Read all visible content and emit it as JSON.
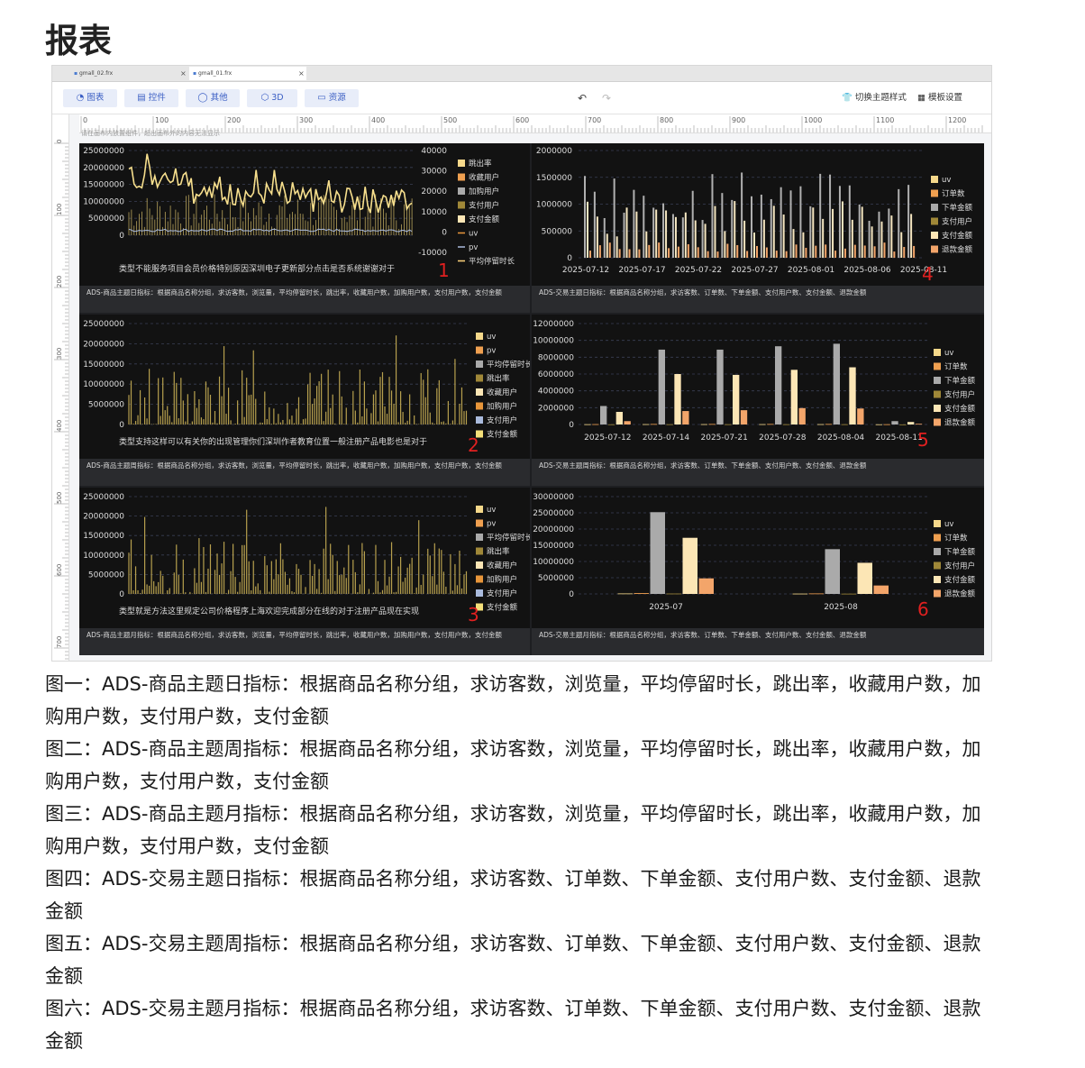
{
  "page_title": "报表",
  "tabs": [
    {
      "label": "gmall_02.frx",
      "close": "×"
    },
    {
      "label": "gmall_01.frx",
      "close": "×"
    }
  ],
  "toolbar": {
    "buttons": [
      {
        "label": "图表",
        "icon": "chart-icon"
      },
      {
        "label": "控件",
        "icon": "widget-icon"
      },
      {
        "label": "其他",
        "icon": "other-icon"
      },
      {
        "label": "3D",
        "icon": "cube-icon"
      },
      {
        "label": "资源",
        "icon": "resource-icon"
      }
    ],
    "undo": "↶",
    "redo": "↷",
    "switch_theme": "切换主题样式",
    "template_settings": "模板设置"
  },
  "ruler": {
    "h_ticks": [
      "0",
      "100",
      "200",
      "300",
      "400",
      "500",
      "600",
      "700",
      "800",
      "900",
      "1000",
      "1100",
      "1200"
    ],
    "v_ticks": [
      "0",
      "100",
      "200",
      "300",
      "400",
      "500",
      "600",
      "700"
    ]
  },
  "hint": "请在画布内放置组件，超出画布外的内容无法显示",
  "panels": [
    {
      "marker": "1",
      "subtitle": "类型不能服务项目会员价格特别原因深圳电子更新部分点击是否系统谢谢对于",
      "desc": "ADS-商品主题日指标：根据商品名称分组，求访客数，浏览量，平均停留时长，跳出率，收藏用户数，加购用户数，支付用户数，支付金额",
      "chart_data": {
        "type": "line",
        "y_left_ticks": [
          "25000000",
          "20000000",
          "15000000",
          "10000000",
          "5000000",
          "0"
        ],
        "y_right_ticks": [
          "40000",
          "30000",
          "20000",
          "10000",
          "0",
          "-10000"
        ],
        "legend": [
          "跳出率",
          "收藏用户",
          "加购用户",
          "支付用户",
          "支付金额",
          "uv",
          "pv",
          "平均停留时长"
        ],
        "legend_colors": [
          "#f5d88a",
          "#f0a050",
          "#aaaaaa",
          "#a08838",
          "#fce6b5",
          "#e8963a",
          "#aabbdd",
          "#ffd27a"
        ],
        "grid": true,
        "legend_position": "right"
      }
    },
    {
      "marker": "2",
      "subtitle": "类型支持这样可以有关你的出现管理你们深圳作者教育位置一般注册产品电影也是对于",
      "desc": "ADS-商品主题周指标：根据商品名称分组，求访客数，浏览量，平均停留时长，跳出率，收藏用户数，加购用户数，支付用户数，支付金额",
      "chart_data": {
        "type": "bar",
        "y_ticks": [
          "25000000",
          "20000000",
          "15000000",
          "10000000",
          "5000000",
          "0"
        ],
        "legend": [
          "uv",
          "pv",
          "平均停留时长",
          "跳出率",
          "收藏用户",
          "加购用户",
          "支付用户",
          "支付金额"
        ],
        "legend_colors": [
          "#f5d88a",
          "#f0a050",
          "#aaaaaa",
          "#a08838",
          "#fce6b5",
          "#e8963a",
          "#aabbdd",
          "#f5e07a"
        ],
        "grid": true,
        "legend_position": "right"
      }
    },
    {
      "marker": "3",
      "subtitle": "类型就是方法这里规定公司价格程序上海欢迎完成部分在线的对于注册产品现在实现",
      "desc": "ADS-商品主题月指标：根据商品名称分组，求访客数，浏览量，平均停留时长，跳出率，收藏用户数，加购用户数，支付用户数，支付金额",
      "chart_data": {
        "type": "bar",
        "y_ticks": [
          "25000000",
          "20000000",
          "15000000",
          "10000000",
          "5000000",
          "0"
        ],
        "legend": [
          "uv",
          "pv",
          "平均停留时长",
          "跳出率",
          "收藏用户",
          "加购用户",
          "支付用户",
          "支付金额"
        ],
        "legend_colors": [
          "#f5d88a",
          "#f0a050",
          "#aaaaaa",
          "#a08838",
          "#fce6b5",
          "#e8963a",
          "#aabbdd",
          "#f5e07a"
        ],
        "grid": true,
        "legend_position": "right"
      }
    },
    {
      "marker": "4",
      "desc": "ADS-交易主题日指标：根据商品名称分组，求访客数、订单数、下单金额、支付用户数、支付金额、退款金额",
      "chart_data": {
        "type": "bar",
        "y_ticks": [
          "2000000",
          "1500000",
          "1000000",
          "500000",
          "0"
        ],
        "x_ticks": [
          "2025-07-12",
          "2025-07-17",
          "2025-07-22",
          "2025-07-27",
          "2025-08-01",
          "2025-08-06",
          "2025-08-11"
        ],
        "legend": [
          "uv",
          "订单数",
          "下单金额",
          "支付用户",
          "支付金额",
          "退款金额"
        ],
        "legend_colors": [
          "#f5d88a",
          "#f0a050",
          "#aaaaaa",
          "#a08838",
          "#fce6b5",
          "#f3a56a"
        ],
        "grid": true,
        "legend_position": "right"
      }
    },
    {
      "marker": "5",
      "desc": "ADS-交易主题周指标：根据商品名称分组，求访客数、订单数、下单金额、支付用户数、支付金额、退款金额",
      "chart_data": {
        "type": "bar",
        "y_ticks": [
          "12000000",
          "10000000",
          "8000000",
          "6000000",
          "4000000",
          "2000000",
          "0"
        ],
        "categories": [
          "2025-07-12",
          "2025-07-14",
          "2025-07-21",
          "2025-07-28",
          "2025-08-04",
          "2025-08-11"
        ],
        "ylim": [
          0,
          12000000
        ],
        "series": [
          {
            "name": "uv",
            "values": [
              30000,
              40000,
              40000,
              40000,
              40000,
              20000
            ]
          },
          {
            "name": "订单数",
            "values": [
              40000,
              60000,
              60000,
              60000,
              60000,
              30000
            ]
          },
          {
            "name": "下单金额",
            "values": [
              2200000,
              8900000,
              8900000,
              9300000,
              9600000,
              400000
            ]
          },
          {
            "name": "支付用户",
            "values": [
              20000,
              30000,
              30000,
              30000,
              30000,
              10000
            ]
          },
          {
            "name": "支付金额",
            "values": [
              1500000,
              6000000,
              5900000,
              6500000,
              6800000,
              300000
            ]
          },
          {
            "name": "退款金额",
            "values": [
              400000,
              1600000,
              1700000,
              1950000,
              1900000,
              80000
            ]
          }
        ],
        "legend": [
          "uv",
          "订单数",
          "下单金额",
          "支付用户",
          "支付金额",
          "退款金额"
        ],
        "legend_colors": [
          "#f5d88a",
          "#f0a050",
          "#aaaaaa",
          "#a08838",
          "#fce6b5",
          "#f3a56a"
        ],
        "grid": true,
        "legend_position": "right"
      }
    },
    {
      "marker": "6",
      "desc": "ADS-交易主题月指标：根据商品名称分组，求访客数、订单数、下单金额、支付用户数、支付金额、退款金额",
      "chart_data": {
        "type": "bar",
        "y_ticks": [
          "30000000",
          "25000000",
          "20000000",
          "15000000",
          "10000000",
          "5000000",
          "0"
        ],
        "categories": [
          "2025-07",
          "2025-08"
        ],
        "ylim": [
          0,
          30000000
        ],
        "series": [
          {
            "name": "uv",
            "values": [
              150000,
              100000
            ]
          },
          {
            "name": "订单数",
            "values": [
              250000,
              150000
            ]
          },
          {
            "name": "下单金额",
            "values": [
              25200000,
              13800000
            ]
          },
          {
            "name": "支付用户",
            "values": [
              120000,
              80000
            ]
          },
          {
            "name": "支付金额",
            "values": [
              17300000,
              9600000
            ]
          },
          {
            "name": "退款金额",
            "values": [
              4800000,
              2600000
            ]
          }
        ],
        "legend": [
          "uv",
          "订单数",
          "下单金额",
          "支付用户",
          "支付金额",
          "退款金额"
        ],
        "legend_colors": [
          "#f5d88a",
          "#f0a050",
          "#aaaaaa",
          "#a08838",
          "#fce6b5",
          "#f3a56a"
        ],
        "grid": true,
        "legend_position": "right"
      }
    }
  ],
  "captions": [
    "图一：ADS-商品主题日指标：根据商品名称分组，求访客数，浏览量，平均停留时长，跳出率，收藏用户数，加购用户数，支付用户数，支付金额",
    "图二：ADS-商品主题周指标：根据商品名称分组，求访客数，浏览量，平均停留时长，跳出率，收藏用户数，加购用户数，支付用户数，支付金额",
    "图三：ADS-商品主题月指标：根据商品名称分组，求访客数，浏览量，平均停留时长，跳出率，收藏用户数，加购用户数，支付用户数，支付金额",
    "图四：ADS-交易主题日指标：根据商品名称分组，求访客数、订单数、下单金额、支付用户数、支付金额、退款金额",
    "图五：ADS-交易主题周指标：根据商品名称分组，求访客数、订单数、下单金额、支付用户数、支付金额、退款金额",
    "图六：ADS-交易主题月指标：根据商品名称分组，求访客数、订单数、下单金额、支付用户数、支付金额、退款金额"
  ]
}
